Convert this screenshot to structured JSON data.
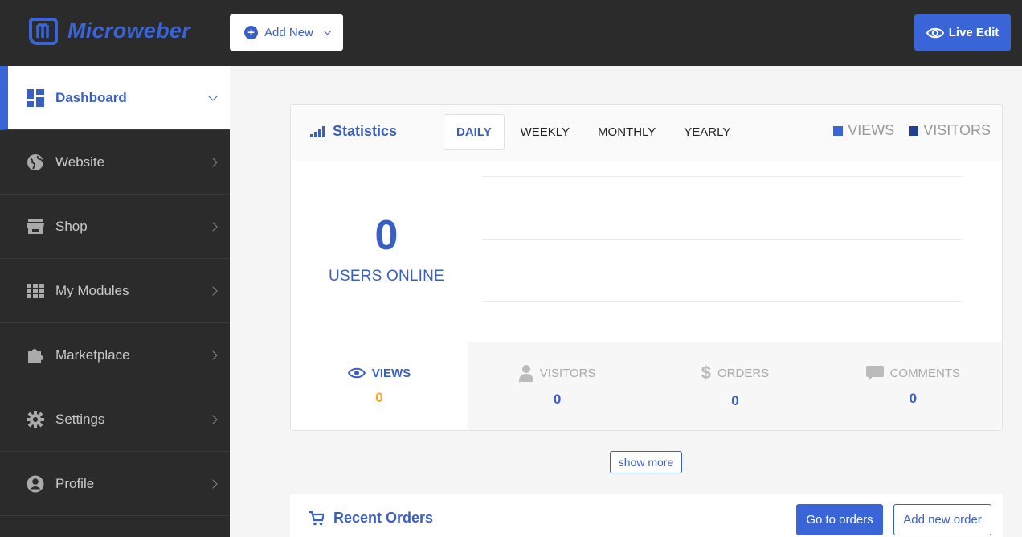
{
  "header": {
    "logo_text": "Microweber",
    "add_new_label": "Add New",
    "live_edit_label": "Live Edit"
  },
  "sidebar": {
    "items": [
      {
        "label": "Dashboard",
        "icon": "dashboard-icon",
        "active": true
      },
      {
        "label": "Website",
        "icon": "globe-icon"
      },
      {
        "label": "Shop",
        "icon": "store-icon"
      },
      {
        "label": "My Modules",
        "icon": "grid-icon"
      },
      {
        "label": "Marketplace",
        "icon": "puzzle-icon"
      },
      {
        "label": "Settings",
        "icon": "gear-icon"
      },
      {
        "label": "Profile",
        "icon": "user-circle-icon"
      }
    ]
  },
  "statistics": {
    "title": "Statistics",
    "tabs": [
      {
        "label": "DAILY",
        "active": true
      },
      {
        "label": "WEEKLY"
      },
      {
        "label": "MONTHLY"
      },
      {
        "label": "YEARLY"
      }
    ],
    "legend": [
      {
        "label": "VIEWS",
        "color": "#3a65d8"
      },
      {
        "label": "VISITORS",
        "color": "#23408e"
      }
    ],
    "users_online_count": "0",
    "users_online_label": "USERS ONLINE",
    "footer": [
      {
        "label": "VIEWS",
        "value": "0",
        "icon": "eye-icon",
        "active": true
      },
      {
        "label": "VISITORS",
        "value": "0",
        "icon": "user-icon"
      },
      {
        "label": "ORDERS",
        "value": "0",
        "icon": "dollar-icon"
      },
      {
        "label": "COMMENTS",
        "value": "0",
        "icon": "comment-icon"
      }
    ]
  },
  "show_more_label": "show more",
  "recent_orders": {
    "title": "Recent Orders",
    "go_to_orders_label": "Go to orders",
    "add_new_order_label": "Add new order"
  },
  "colors": {
    "accent": "#3a65d8",
    "sidebar_bg": "#2b2b2b",
    "highlight_value": "#f5a623"
  }
}
